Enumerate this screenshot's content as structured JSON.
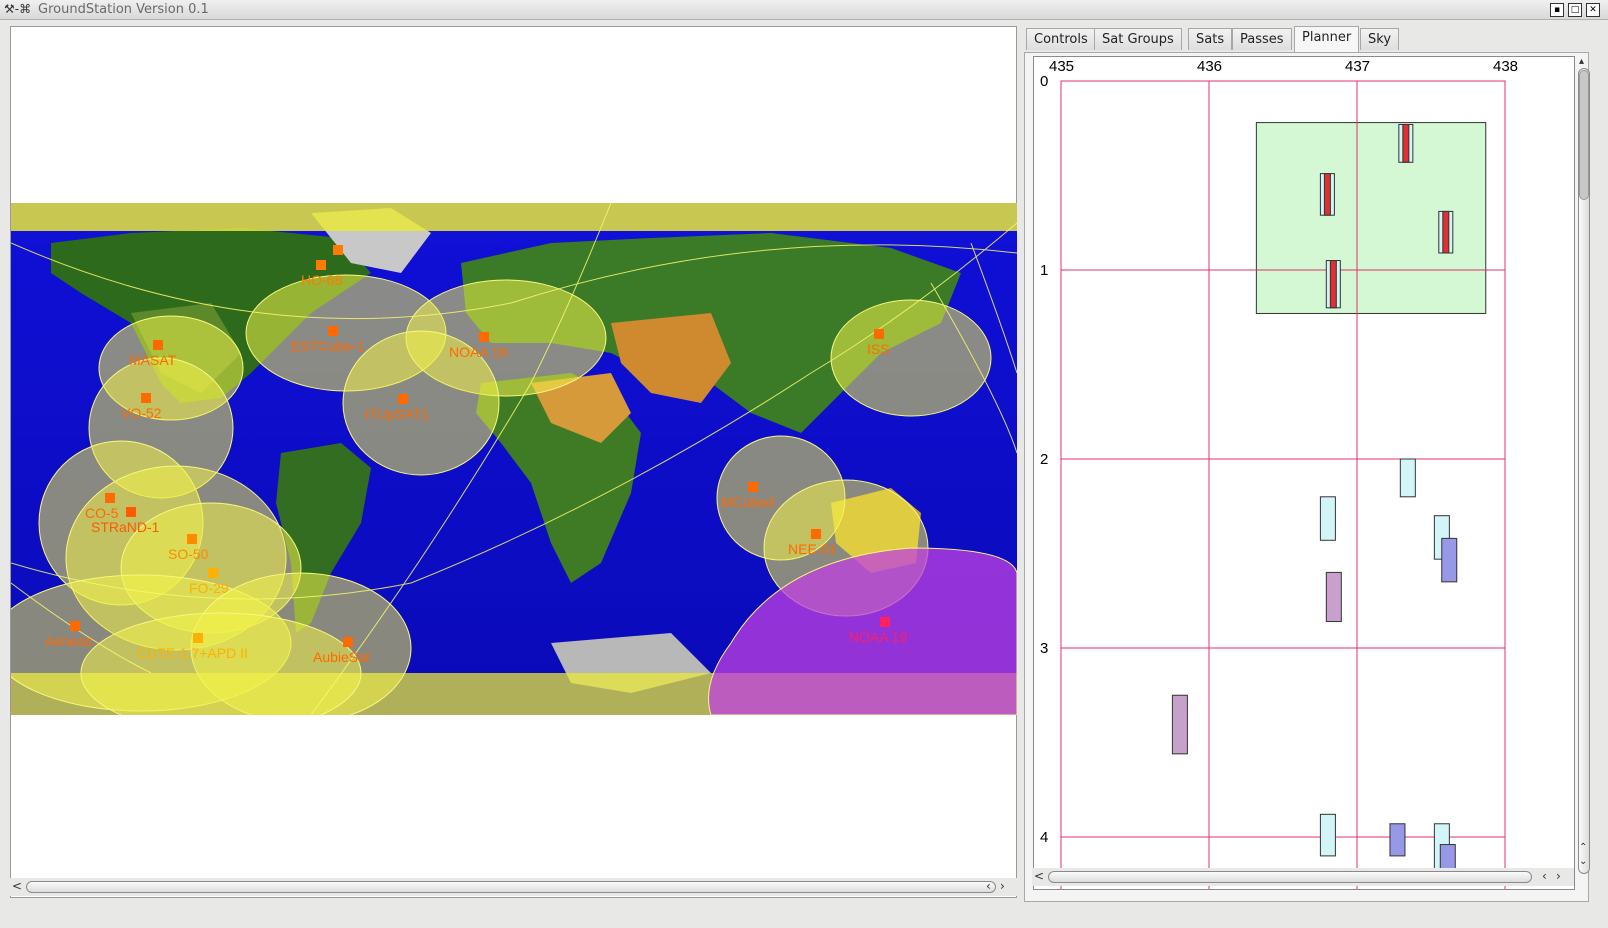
{
  "window": {
    "title": "GroundStation Version 0.1"
  },
  "tabs": [
    {
      "label": "Controls"
    },
    {
      "label": "Sat Groups"
    },
    {
      "label": "Sats"
    },
    {
      "label": "Passes"
    },
    {
      "label": "Planner",
      "active": true
    },
    {
      "label": "Sky"
    }
  ],
  "map": {
    "satellites": [
      {
        "label": "HO-68",
        "color": "#ff7a00"
      },
      {
        "label": "ESTCube-1",
        "color": "#ff6a00"
      },
      {
        "label": "MASAT",
        "color": "#ff6a00"
      },
      {
        "label": "NOAA 18",
        "color": "#ff6a00"
      },
      {
        "label": "ISS",
        "color": "#ff6a00"
      },
      {
        "label": "VO-52",
        "color": "#ff6a00"
      },
      {
        "label": "ITUpSAT1",
        "color": "#ff6a00"
      },
      {
        "label": "CO-5",
        "color": "#ff6a00"
      },
      {
        "label": "STRaND-1",
        "color": "#ff5a00"
      },
      {
        "label": "SO-50",
        "color": "#ff8a00"
      },
      {
        "label": "FO-29",
        "color": "#ffb000"
      },
      {
        "label": "MCubed",
        "color": "#ff6a00"
      },
      {
        "label": "NEE-01",
        "color": "#ff6a00"
      },
      {
        "label": "NOAA 19",
        "color": "#ff2060"
      },
      {
        "label": "Aeneas",
        "color": "#ff6a00"
      },
      {
        "label": "CUTE-1.7+APD II",
        "color": "#ffb000"
      },
      {
        "label": "AubieSat",
        "color": "#ff6a00"
      }
    ]
  },
  "planner": {
    "x_axis_labels": [
      "435",
      "436",
      "437",
      "438"
    ],
    "y_axis_labels": [
      "0",
      "1",
      "2",
      "3",
      "4"
    ],
    "grid_color": "#e0306a",
    "highlight_color": "#d4f7d4",
    "pass_colors": {
      "red": "#e03030",
      "cyan": "#d2f6f8",
      "violet": "#c8a0cc",
      "blue": "#9898e8"
    },
    "passes": [
      {
        "freq": 437.33,
        "t0": 0.23,
        "t1": 0.43,
        "kind": "red"
      },
      {
        "freq": 436.8,
        "t0": 0.49,
        "t1": 0.71,
        "kind": "red"
      },
      {
        "freq": 437.6,
        "t0": 0.69,
        "t1": 0.91,
        "kind": "red"
      },
      {
        "freq": 436.84,
        "t0": 0.95,
        "t1": 1.2,
        "kind": "red"
      },
      {
        "freq": 437.34,
        "t0": 2.0,
        "t1": 2.2,
        "kind": "cyan"
      },
      {
        "freq": 436.8,
        "t0": 2.2,
        "t1": 2.43,
        "kind": "cyan"
      },
      {
        "freq": 437.57,
        "t0": 2.3,
        "t1": 2.53,
        "kind": "cyan"
      },
      {
        "freq": 437.62,
        "t0": 2.42,
        "t1": 2.65,
        "kind": "blue"
      },
      {
        "freq": 436.84,
        "t0": 2.6,
        "t1": 2.86,
        "kind": "violet"
      },
      {
        "freq": 435.8,
        "t0": 3.25,
        "t1": 3.56,
        "kind": "violet"
      },
      {
        "freq": 436.8,
        "t0": 3.88,
        "t1": 4.1,
        "kind": "cyan"
      },
      {
        "freq": 437.27,
        "t0": 3.93,
        "t1": 4.1,
        "kind": "blue"
      },
      {
        "freq": 437.57,
        "t0": 3.93,
        "t1": 4.2,
        "kind": "cyan"
      },
      {
        "freq": 437.61,
        "t0": 4.04,
        "t1": 4.2,
        "kind": "blue"
      }
    ],
    "highlight": {
      "freq0": 436.32,
      "freq1": 437.87,
      "t0": 0.22,
      "t1": 1.23
    }
  }
}
